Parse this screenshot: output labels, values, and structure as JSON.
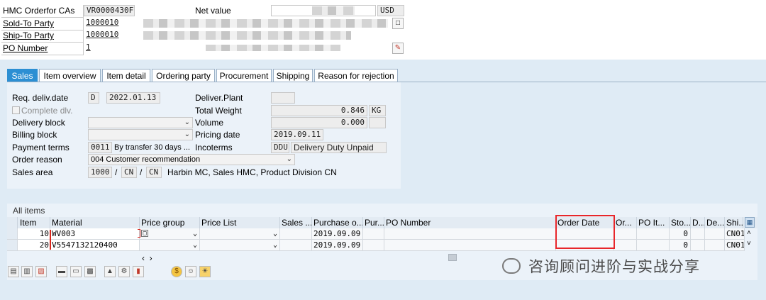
{
  "header": {
    "order_label": "HMC Orderfor CAs",
    "order_value": "VR0000430F",
    "net_value_label": "Net value",
    "currency": "USD",
    "sold_to_label": "Sold-To Party",
    "sold_to_value": "1000010",
    "ship_to_label": "Ship-To Party",
    "ship_to_value": "1000010",
    "po_label": "PO Number",
    "po_value": "1"
  },
  "tabs": [
    "Sales",
    "Item overview",
    "Item detail",
    "Ordering party",
    "Procurement",
    "Shipping",
    "Reason for rejection"
  ],
  "sales": {
    "req_deliv_label": "Req. deliv.date",
    "req_deliv_type": "D",
    "req_deliv_date": "2022.01.13",
    "complete_dlv_label": "Complete dlv.",
    "delivery_block_label": "Delivery block",
    "billing_block_label": "Billing block",
    "payment_terms_label": "Payment terms",
    "payment_terms_code": "0011",
    "payment_terms_text": "By transfer 30 days ...",
    "order_reason_label": "Order reason",
    "order_reason_value": "004 Customer recommendation",
    "sales_area_label": "Sales area",
    "sales_org": "1000",
    "dist_channel": "CN",
    "division": "CN",
    "sales_area_text": "Harbin MC, Sales HMC, Product Division CN",
    "slash1": "/",
    "slash2": "/",
    "deliver_plant_label": "Deliver.Plant",
    "total_weight_label": "Total Weight",
    "total_weight_value": "0.846",
    "weight_unit": "KG",
    "volume_label": "Volume",
    "volume_value": "0.000",
    "pricing_date_label": "Pricing date",
    "pricing_date_value": "2019.09.11",
    "incoterms_label": "Incoterms",
    "incoterms_code": "DDU",
    "incoterms_text": "Delivery Duty Unpaid"
  },
  "items": {
    "section_title": "All items",
    "columns": [
      "Item",
      "Material",
      "Price group",
      "Price List",
      "Sales ...",
      "Purchase o...",
      "Pur...",
      "PO Number",
      "Order Date",
      "Or...",
      "PO It...",
      "Sto...",
      "D...",
      "De...",
      "Shi..."
    ],
    "rows": [
      {
        "item": "10",
        "material": "WV003",
        "purchase_date": "2019.09.09",
        "sto": "0",
        "shi": "CN01"
      },
      {
        "item": "20",
        "material": "V5547132120400",
        "purchase_date": "2019.09.09",
        "sto": "0",
        "shi": "CN01"
      }
    ]
  },
  "watermark": "咨询顾问进阶与实战分享",
  "colors": {
    "active_tab": "#2c8fd3",
    "highlight_box": "#e8262a",
    "background": "#dfebf5"
  }
}
